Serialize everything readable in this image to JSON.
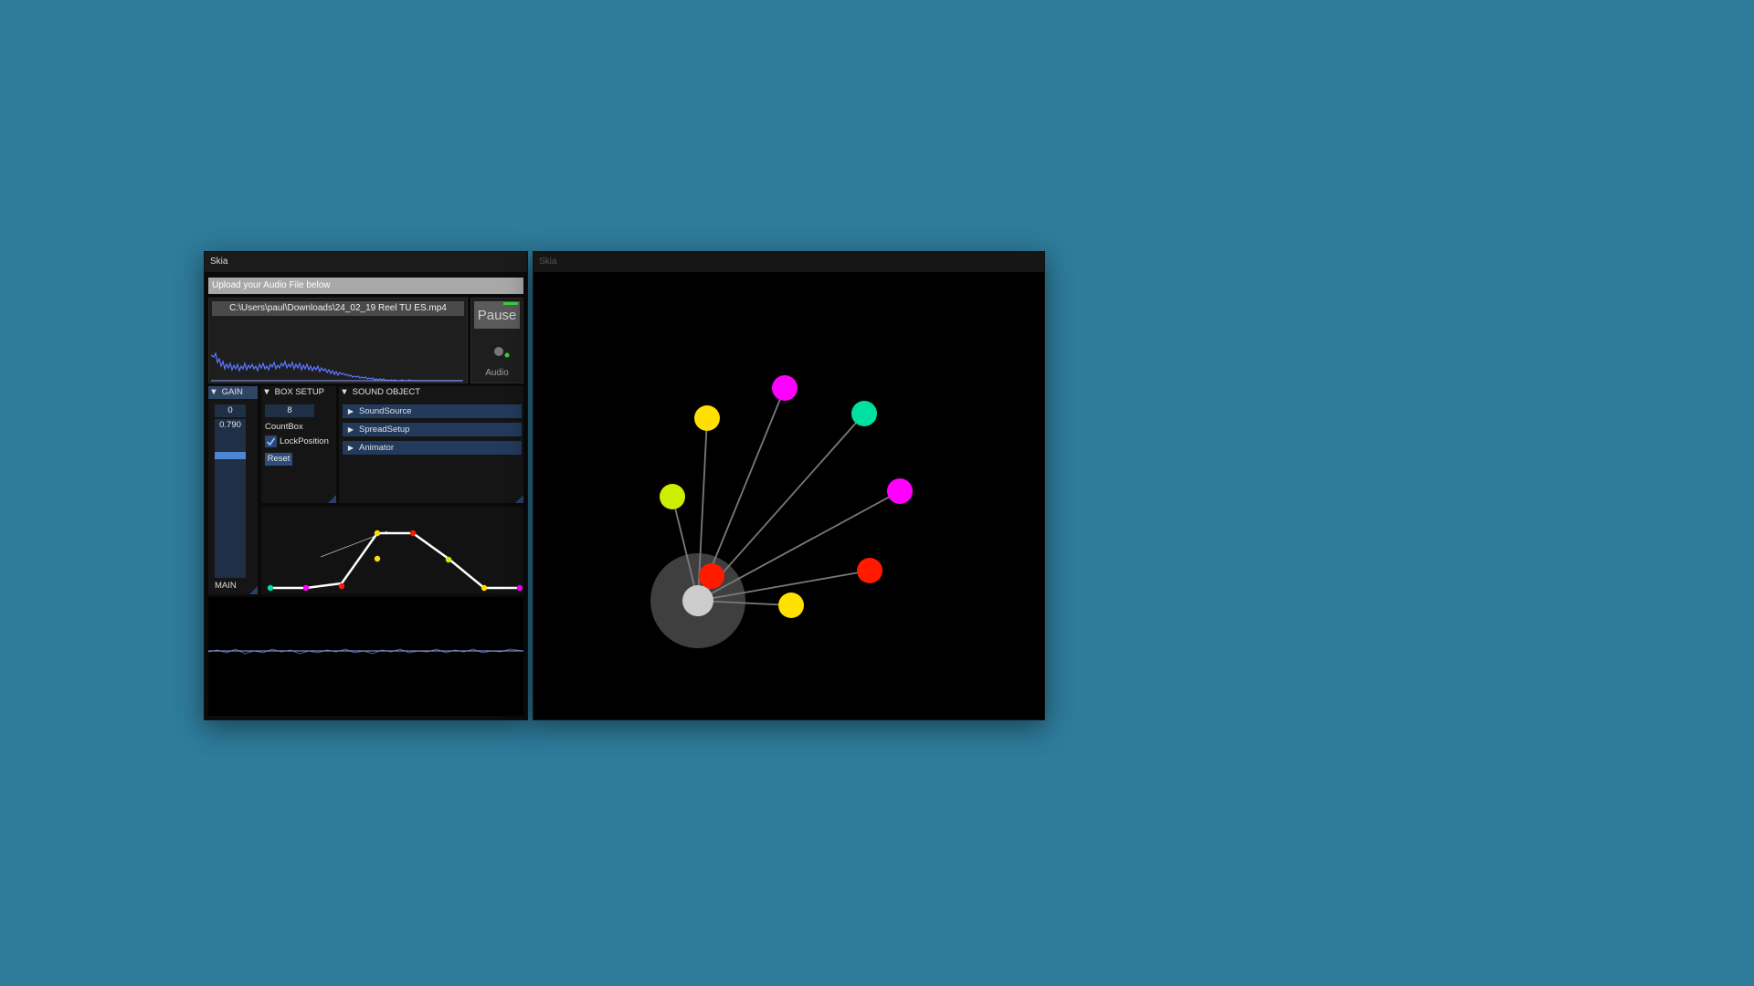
{
  "left_window": {
    "title": "Skia",
    "upload_label": "Upload your Audio File below",
    "file_path": "C:\\Users\\paul\\Downloads\\24_02_19 Reel TU ES.mp4",
    "pause_label": "Pause",
    "audio_label": "Audio",
    "gain": {
      "header": "GAIN",
      "value_top": "0",
      "value_current": "0.790",
      "slider_level": 0.79,
      "main_label": "MAIN"
    },
    "box_setup": {
      "header": "BOX SETUP",
      "count_value": "8",
      "count_label": "CountBox",
      "lock_label": "LockPosition",
      "lock_checked": true,
      "reset_label": "Reset"
    },
    "sound_object": {
      "header": "SOUND OBJECT",
      "items": [
        {
          "label": "SoundSource"
        },
        {
          "label": "SpreadSetup"
        },
        {
          "label": "Animator"
        }
      ]
    },
    "icons": {
      "collapse": "triangle-down-icon",
      "expand": "triangle-right-icon",
      "check": "check-icon"
    }
  },
  "right_window": {
    "title": "Skia"
  },
  "colors": {
    "desktop": "#2e7b9a",
    "accent": "#4c86d0",
    "yellow": "#ffe000",
    "magenta": "#ff00ff",
    "teal": "#00e0a0",
    "lime": "#ccee00",
    "red": "#ff1a00",
    "center": "#cccccc"
  }
}
